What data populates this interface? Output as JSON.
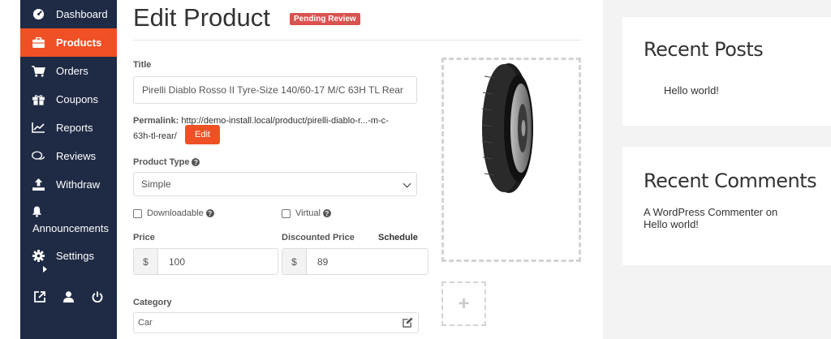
{
  "sidebar": {
    "items": [
      {
        "label": "Dashboard",
        "icon": "dashboard-icon"
      },
      {
        "label": "Products",
        "icon": "briefcase-icon",
        "active": true
      },
      {
        "label": "Orders",
        "icon": "cart-icon"
      },
      {
        "label": "Coupons",
        "icon": "gift-icon"
      },
      {
        "label": "Reports",
        "icon": "chart-icon"
      },
      {
        "label": "Reviews",
        "icon": "comments-icon"
      },
      {
        "label": "Withdraw",
        "icon": "upload-icon"
      }
    ],
    "announcements": {
      "label": "Announcements",
      "icon": "bell-icon"
    },
    "settings": {
      "label": "Settings",
      "icon": "gear-icon"
    },
    "bottom_icons": [
      "external-link-icon",
      "user-icon",
      "power-icon"
    ],
    "colors": {
      "background": "#1f2b45",
      "active": "#f05025"
    }
  },
  "main": {
    "title": "Edit Product",
    "status_badge": "Pending Review",
    "title_label": "Title",
    "title_value": "Pirelli Diablo Rosso II Tyre-Size 140/60-17 M/C 63H TL Rear",
    "permalink_label": "Permalink:",
    "permalink_url_line1": "http://demo-install.local/product/pirelli-diablo-r...-m-c-",
    "permalink_url_line2": "63h-tl-rear/",
    "edit_button": "Edit",
    "product_type_label": "Product Type",
    "product_type_value": "Simple",
    "downloadable_label": "Downloadable",
    "virtual_label": "Virtual",
    "price_label": "Price",
    "price_currency": "$",
    "price_value": "100",
    "discounted_price_label": "Discounted Price",
    "schedule_label": "Schedule",
    "discount_currency": "$",
    "discount_value": "89",
    "category_label": "Category",
    "category_value": "Car",
    "gallery_add_symbol": "+"
  },
  "widgets": {
    "recent_posts_title": "Recent Posts",
    "recent_posts": [
      "Hello world!"
    ],
    "recent_comments_title": "Recent Comments",
    "comment_author": "A WordPress Commenter",
    "comment_on": "on",
    "comment_post": "Hello world!"
  }
}
